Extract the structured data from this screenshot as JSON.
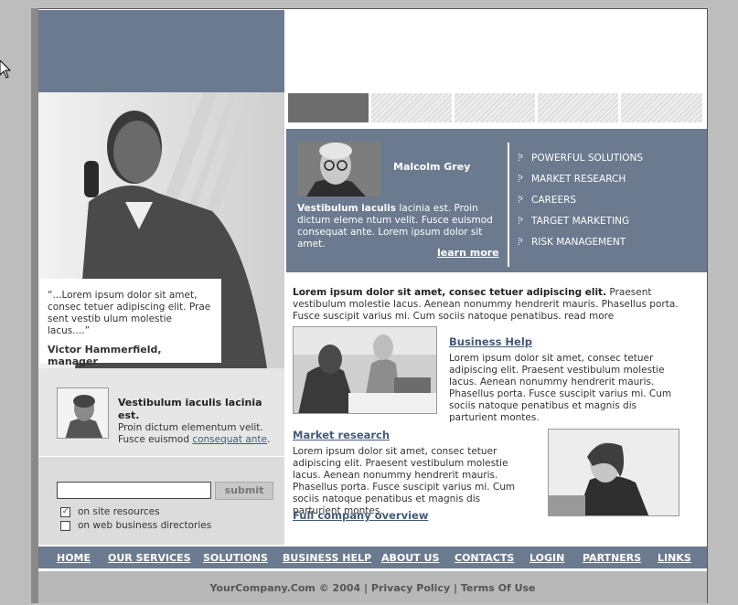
{
  "quote": {
    "text": "“...Lorem ipsum dolor sit amet, consec tetuer adipiscing elit. Prae sent vestib ulum molestie lacus....”",
    "author": "Victor Hammerfield, manager"
  },
  "profile": {
    "title": "Vestibulum iaculis lacinia est.",
    "text": "Proin dictum elementum velit. Fusce euismod ",
    "link": "consequat ante",
    "after": "."
  },
  "search": {
    "value": "",
    "submit_label": "submit",
    "options": [
      {
        "label": "on site resources",
        "checked": true
      },
      {
        "label": "on web business directories",
        "checked": false
      }
    ]
  },
  "featured": {
    "name": "Malcolm Grey",
    "lead": "Vestibulum iaculis",
    "text": " lacinia est. Proin dictum eleme ntum velit. Fusce euismod consequat ante. Lorem ipsum dolor sit amet.",
    "learn_more": "learn more"
  },
  "side_menu": [
    "POWERFUL SOLUTIONS",
    "MARKET RESEARCH",
    "CAREERS",
    "TARGET MARKETING",
    "RISK MANAGEMENT"
  ],
  "intro": {
    "lead": "Lorem ipsum dolor sit amet, consec tetuer adipiscing elit.",
    "text": " Praesent vestibulum molestie lacus. Aenean nonummy hendrerit mauris. Phasellus porta. Fusce suscipit varius mi. Cum sociis natoque penatibus. ",
    "read_more": "read more"
  },
  "business_help": {
    "title": "Business Help",
    "text": "Lorem ipsum dolor sit amet, consec tetuer adipiscing elit. Praesent vestibulum molestie lacus. Aenean nonummy hendrerit mauris. Phasellus porta. Fusce suscipit varius mi. Cum sociis natoque penatibus et magnis dis parturient montes."
  },
  "market_research": {
    "title": "Market research",
    "text": "Lorem ipsum dolor sit amet, consec tetuer adipiscing elit. Praesent vestibulum molestie lacus. Aenean nonummy hendrerit mauris. Phasellus porta. Fusce suscipit varius mi. Cum sociis natoque penatibus et magnis dis parturient montes."
  },
  "overview_link": "Full company overview",
  "nav": [
    "HOME",
    "OUR SERVICES",
    "SOLUTIONS",
    "BUSINESS HELP",
    "ABOUT US",
    "CONTACTS",
    "LOGIN",
    "PARTNERS",
    "LINKS"
  ],
  "footer": {
    "copyright": "YourCompany.Com © 2004",
    "sep": "|",
    "privacy": "Privacy Policy",
    "terms": "Terms Of Use"
  },
  "colors": {
    "accent": "#6b7a8f",
    "link": "#445a79"
  }
}
